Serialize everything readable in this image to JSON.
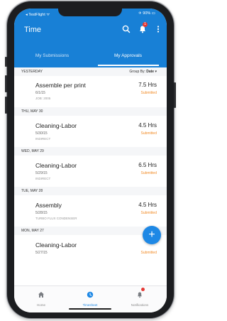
{
  "status_bar": {
    "carrier": "◂ TestFlight ᯤ",
    "battery": "✈ 90% ▭"
  },
  "app": {
    "title": "Time"
  },
  "header_icons": {
    "search": "search-icon",
    "alerts_badge": "1",
    "menu": "more-vertical-icon"
  },
  "tabs": [
    {
      "label": "My Submissions",
      "active": false
    },
    {
      "label": "My Approvals",
      "active": true
    }
  ],
  "group_by": {
    "label": "Group By:",
    "value": "Date"
  },
  "sections": [
    {
      "header": "YESTERDAY",
      "item": {
        "title": "Assemble per print",
        "date": "6/1/15",
        "sub": "JOB: 2005",
        "hours": "7.5 Hrs",
        "status": "Submitted"
      }
    },
    {
      "header": "THU, MAY 30",
      "item": {
        "title": "Cleaning-Labor",
        "date": "5/30/15",
        "sub": "INDIRECT",
        "hours": "4.5 Hrs",
        "status": "Submitted"
      }
    },
    {
      "header": "WED, MAY 29",
      "item": {
        "title": "Cleaning-Labor",
        "date": "5/29/15",
        "sub": "INDIRECT",
        "hours": "6.5 Hrs",
        "status": "Submitted"
      }
    },
    {
      "header": "TUE, MAY 28",
      "item": {
        "title": "Assembly",
        "date": "5/28/15",
        "sub": "TURBO FLUX CONDENSER",
        "hours": "4.5 Hrs",
        "status": "Submitted"
      }
    },
    {
      "header": "MON, MAY 27",
      "item": {
        "title": "Cleaning-Labor",
        "date": "5/27/15",
        "sub": "",
        "hours": "",
        "status": "Submitted"
      }
    }
  ],
  "fab": {
    "label": "+"
  },
  "bottom_nav": [
    {
      "label": "Home",
      "icon": "home-icon",
      "active": false
    },
    {
      "label": "Timesheet",
      "icon": "clock-icon",
      "active": true
    },
    {
      "label": "Notifications",
      "icon": "bell-icon",
      "active": false
    }
  ],
  "colors": {
    "primary": "#1880d6",
    "status": "#f28c28",
    "badge": "#e53935"
  }
}
